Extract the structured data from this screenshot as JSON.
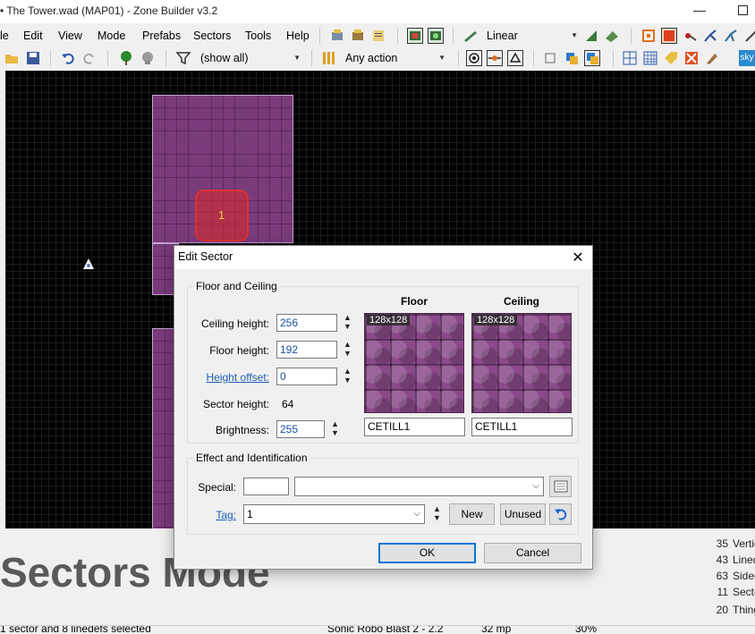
{
  "window": {
    "title": "• The Tower.wad (MAP01) - Zone Builder v3.2",
    "minimize": "—"
  },
  "menubar": {
    "items": [
      "le",
      "Edit",
      "View",
      "Mode",
      "Prefabs",
      "Sectors",
      "Tools",
      "Help"
    ]
  },
  "toolbar": {
    "view_mode": "Linear",
    "filter": "(show all)",
    "action_filter": "Any action",
    "sky_label": "sky"
  },
  "canvas": {
    "selected_sector_number": "1"
  },
  "bottom": {
    "mode_title": "Sectors Mode",
    "stats": [
      {
        "count": "35",
        "label": "Vertic"
      },
      {
        "count": "43",
        "label": "Lined"
      },
      {
        "count": "63",
        "label": "Sided"
      },
      {
        "count": "11",
        "label": "Secto"
      },
      {
        "count": "20",
        "label": "Thing"
      }
    ]
  },
  "statusbar": {
    "selection": "1 sector and 8 linedefs selected",
    "game_config": "Sonic Robo Blast 2 - 2.2",
    "grid": "32 mp",
    "zoom": "30%"
  },
  "dialog": {
    "title": "Edit Sector",
    "close": "✕",
    "floor_ceiling": {
      "group_title": "Floor and Ceiling",
      "ceiling_height_label": "Ceiling height:",
      "ceiling_height": "256",
      "floor_height_label": "Floor height:",
      "floor_height": "192",
      "height_offset_label": "Height offset:",
      "height_offset": "0",
      "sector_height_label": "Sector height:",
      "sector_height": "64",
      "brightness_label": "Brightness:",
      "brightness": "255",
      "floor_header": "Floor",
      "ceiling_header": "Ceiling",
      "floor_tex_size": "128x128",
      "ceiling_tex_size": "128x128",
      "floor_texture": "CETILL1",
      "ceiling_texture": "CETILL1"
    },
    "effect": {
      "group_title": "Effect and Identification",
      "special_label": "Special:",
      "special_value": "",
      "special_effect": "",
      "tag_label": "Tag:",
      "tag_value": "1",
      "new_button": "New",
      "unused_button": "Unused"
    },
    "ok_button": "OK",
    "cancel_button": "Cancel"
  }
}
